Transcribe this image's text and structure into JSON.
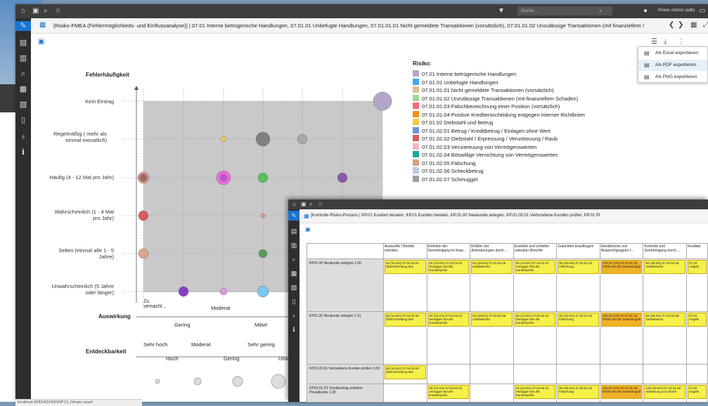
{
  "search": {
    "placeholder": "Suche..."
  },
  "user": {
    "label": "Power Adonis (adb)"
  },
  "title": "[Risiko-FMEA (Fehlermöglichkeits- und Einflussanalyse)] | 07.01 Interne betrügerische Handlungen, 07.01.01 Unbefugte Handlungen, 07.01.01.01 Nicht gemeldete Transaktionen (vorsätzlich), 07.01.01.02 Unzulässige Transaktionen (mit finanziellem S...",
  "export_menu": {
    "items": [
      "Als Excel exportieren",
      "Als PDF exportieren",
      "Als PNG exportieren"
    ]
  },
  "chart_data": {
    "type": "scatter",
    "ylabel": "Fehlerhäufigkeit",
    "xlabel": "Auswirkung",
    "y_categories": [
      "Unwahrscheinlich (5 Jahre oder länger)",
      "Selten (einmal alle 1 - 5 Jahre)",
      "Wahrscheinlich (1 - 4 Mal pro Jahr)",
      "Häufig (4 - 12 Mal pro Jahr)",
      "Regelmäßig ( mehr als einmal monatlich)",
      "Kein Eintrag"
    ],
    "x_categories": [
      "Zu vernachl...",
      "Gering",
      "Moderat",
      "Mittel"
    ],
    "detect_label": "Entdeckbarkeit",
    "detect_categories": [
      "Sehr hoch",
      "Hoch",
      "Moderat",
      "Gering",
      "Sehr gering",
      "Unwah"
    ]
  },
  "legend": {
    "title": "Risiko:",
    "items": [
      {
        "label": "07.01 Interne betrügerische Handlungen",
        "color": "#b5a6c9"
      },
      {
        "label": "07.01.01 Unbefugte Handlungen",
        "color": "#3fa9f5"
      },
      {
        "label": "07.01.01.01 Nicht gemeldete Transaktionen (vorsätzlich)",
        "color": "#ddc08a"
      },
      {
        "label": "07.01.01.02 Unzulässige Transaktionen (mit finanziellem Schaden)",
        "color": "#9fd79a"
      },
      {
        "label": "07.01.01.03 Falschbezeichnung einer Position (vorsätzlich)",
        "color": "#ef6b7a"
      },
      {
        "label": "07.01.01.04 Positive Kreditentscheidung entgegen interner Richtlinien",
        "color": "#f3901c"
      },
      {
        "label": "07.01.02 Diebstahl und Betrug",
        "color": "#f7c84a"
      },
      {
        "label": "07.01.02.01 Betrug / Kreditbetrug / Einlagen ohne Wert",
        "color": "#6f93d9"
      },
      {
        "label": "07.01.02.02 Diebstahl / Erpressung / Veruntreuung / Raub",
        "color": "#d85b5b"
      },
      {
        "label": "07.01.02.03 Veruntreuung von Vermögenswerten",
        "color": "#f4b6c0"
      },
      {
        "label": "07.01.02.04 Böswillige Vernichtung von Vermögenswerten",
        "color": "#1aa8a0"
      },
      {
        "label": "07.01.02.05 Fälschung",
        "color": "#d8a080"
      },
      {
        "label": "07.01.02.06 Scheckbetrug",
        "color": "#b9c9e6"
      },
      {
        "label": "07.01.02.07 Schmuggel",
        "color": "#9aa0a6"
      }
    ]
  },
  "second": {
    "title": "[Kontrolle-Risiko-Prozess | KP.01 Kunden beraten, KP.01 Kunden beraten, KP.01.00 Neukunde anlegen, KP.01.00.01 Verbundene Kunden prüfen, KP.01 Pr",
    "cols": [
      "Auskünfte / Bonität einholen",
      "Einholen der Genehmigung im finan...",
      "Erfüllen der Anforderungen durch ...",
      "Erstellen und verteilen zeitnaher Berichte",
      "Gutachten beauftragen",
      "Identifizieren von Ansprechgruppen f...",
      "Kontrolle und Genehmigung durch ...",
      "Kreditan"
    ],
    "rows": [
      {
        "label": "KP01.00 Neukunde anlegen 1.00"
      },
      {
        "label": "KP01.00 Neukunde anlegen 1.01"
      },
      {
        "label": "KP01.00.01 Verbundene Kunden prüfen 1.00"
      },
      {
        "label": "KP02.01-P1 Kreditantrag erstellen Privatkunde 1.00"
      }
    ],
    "notes": {
      "bonitaet": "48 (16.3%) 07.04.04.02 Überschreitung des",
      "versagen": "40 (13.6%) 07.04.04.01 Versagen bei der Kundenprüfu",
      "geldwaesche": "84 (28.6%) 07.04.02.06 Geldwäsche",
      "versagen2": "40 (13.6%) 07.04.04.01 Versagen bei der Kundenprüfu",
      "faelschung": "90 (30.6%) 07.02.01.02 Fälschung",
      "fehler": "140 (47.6%) 07.07.01.02 Fehler bei der Dateneingab",
      "geldwaesche2": "84 (28.6%) 07.04.02.06 Geldwäsche",
      "verletzung": "120 (40.8%) 07.04.01.03 Verletzung von Inform",
      "kredit": "07.04 Angele"
    }
  },
  "status": "localhost:9083/ADONISNP10_0/main.view#"
}
